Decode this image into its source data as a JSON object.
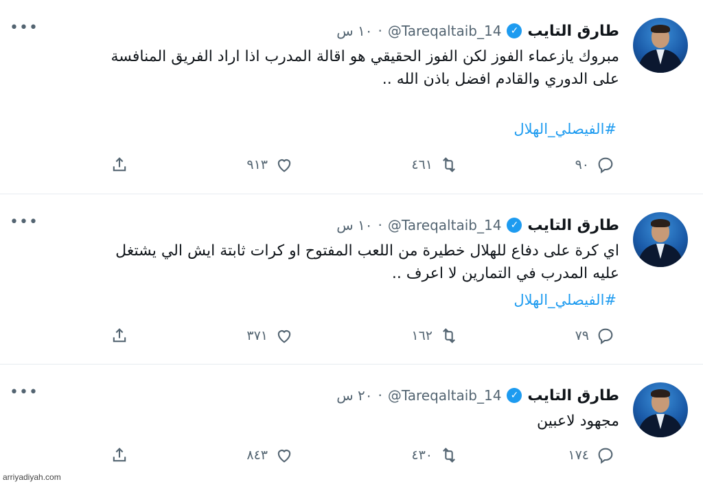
{
  "user": {
    "name": "طارق التايب",
    "handle": "@Tareqaltaib_14",
    "verified": true
  },
  "hashtag": "#الفيصلي_الهلال",
  "tweets": [
    {
      "time": "١٠ س",
      "text_lines": [
        "مبروك يازعماء الفوز لكن الفوز الحقيقي هو اقالة المدرب اذا اراد الفريق المنافسة",
        "على الدوري والقادم افضل باذن الله .."
      ],
      "hashtag": "#الفيصلي_الهلال",
      "replies": "٩٠",
      "retweets": "٤٦١",
      "likes": "٩١٣"
    },
    {
      "time": "١٠ س",
      "text_lines": [
        "اي كرة على دفاع للهلال خطيرة من اللعب المفتوح او كرات ثابتة ايش الي يشتغل",
        "عليه المدرب في التمارين لا اعرف .."
      ],
      "hashtag": "#الفيصلي_الهلال",
      "replies": "٧٩",
      "retweets": "١٦٢",
      "likes": "٣٧١"
    },
    {
      "time": "٢٠ س",
      "text_lines": [
        "مجهود لاعبين"
      ],
      "hashtag": "",
      "replies": "١٧٤",
      "retweets": "٤٣٠",
      "likes": "٨٤٣"
    }
  ],
  "watermark": "arriyadiyah.com",
  "icons": {
    "more": "more-horizontal-icon",
    "reply": "reply-icon",
    "retweet": "retweet-icon",
    "like": "heart-icon",
    "share": "share-icon",
    "verified": "verified-badge-icon"
  },
  "colors": {
    "accent": "#1d9bf0",
    "muted": "#536471",
    "text": "#0f1419"
  }
}
